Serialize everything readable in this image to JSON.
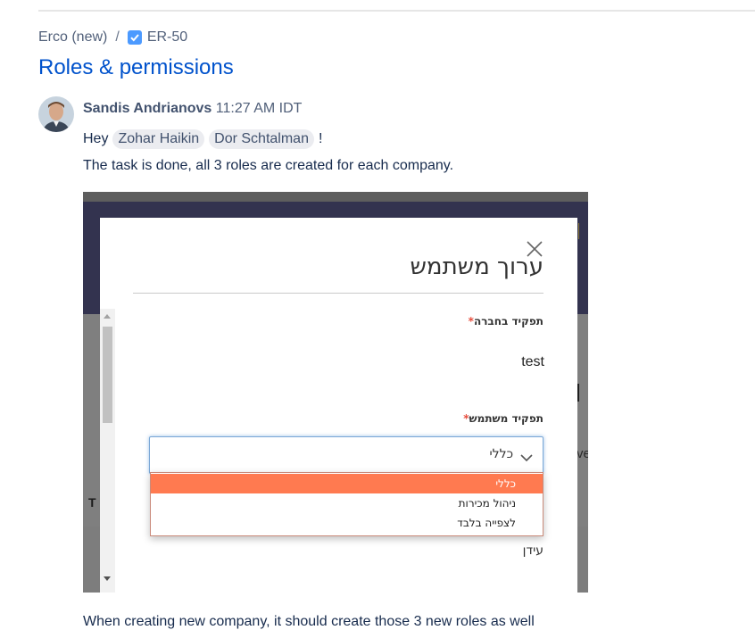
{
  "breadcrumb": {
    "project": "Erco (new)",
    "separator": "/",
    "issue_key": "ER-50"
  },
  "page_title": "Roles & permissions",
  "comment": {
    "author": "Sandis Andrianovs",
    "time": "11:27 AM IDT",
    "greeting_prefix": "Hey",
    "mentions": [
      "Zohar Haikin",
      "Dor Schtalman"
    ],
    "greeting_suffix": "!",
    "body_line_1": "The task is done, all 3 roles are created for each company.",
    "body_line_2": "When creating new company, it should create those 3 new roles as well"
  },
  "embedded_screenshot": {
    "modal_title": "ערוך משתמש",
    "company_role_label": "תפקיד בחברה",
    "company_role_value": "test",
    "user_role_label": "תפקיד משתמש",
    "user_role_selected": "כללי",
    "user_role_options": [
      "כללי",
      "ניהול מכירות",
      "לצפייה בלבד"
    ],
    "next_field_value": "עידן",
    "background_text_left": "T",
    "background_text_right": "ve"
  },
  "colors": {
    "link": "#0052cc",
    "mention_bg": "#ebecf0",
    "option_highlight": "#ff7a50",
    "required_star": "#e74c3c"
  }
}
